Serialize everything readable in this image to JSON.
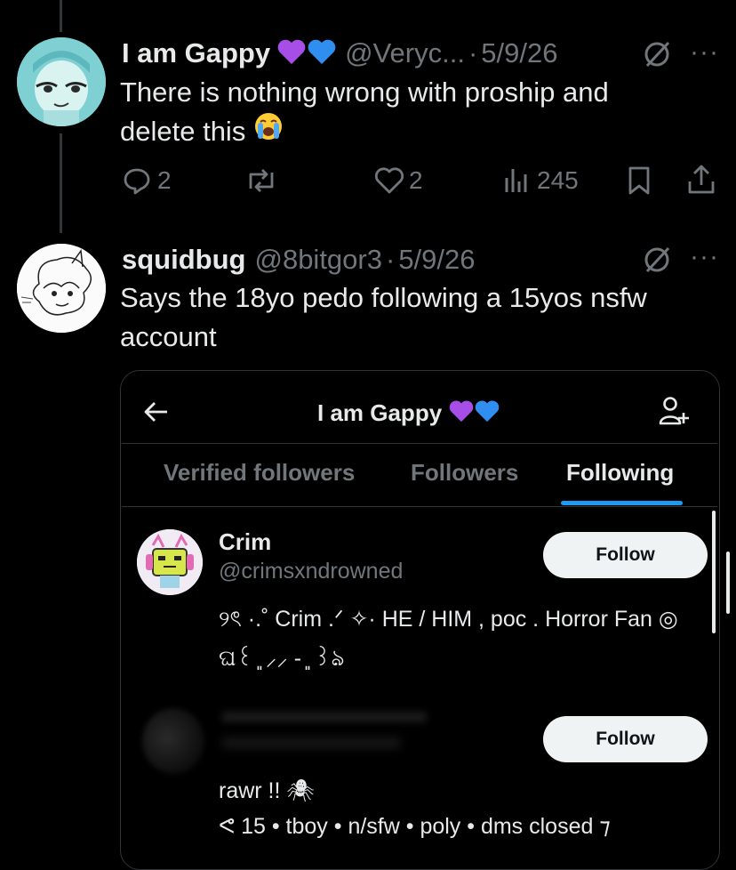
{
  "tweet1": {
    "name": "I am Gappy",
    "handle": "@Veryc...",
    "sep": "·",
    "date": "5/9/26",
    "text_line1": "There is nothing wrong with proship and",
    "text_line2": "delete this",
    "replies": "2",
    "likes": "2",
    "views": "245",
    "more": "···"
  },
  "tweet2": {
    "name": "squidbug",
    "handle": "@8bitgor3",
    "sep": "·",
    "date": "5/9/26",
    "text_line1": "Says the 18yo pedo following a 15yos nsfw",
    "text_line2": "account",
    "more": "···"
  },
  "screenshot": {
    "title": "I am Gappy",
    "tabs": [
      "Verified followers",
      "Followers",
      "Following"
    ],
    "active_tab": "Following",
    "accent": "#1d9bf0",
    "users": [
      {
        "name": "Crim",
        "handle": "@crimsxndrowned",
        "button": "Follow",
        "bio_line1": "୨ৎ ·.˚ Crim .ᐟ ✧· HE / HIM , poc . Horror Fan ◎",
        "bio_line2": "ଘ꒰ ͈ ⸝⸝ - ͈ ꒱ঌ"
      },
      {
        "name": "",
        "handle": "",
        "button": "Follow",
        "bio_line1": "rawr !! 🕷",
        "bio_line2": "ᕙ 15 • tboy • n/sfw • poly • dms closed ⁊"
      }
    ]
  }
}
